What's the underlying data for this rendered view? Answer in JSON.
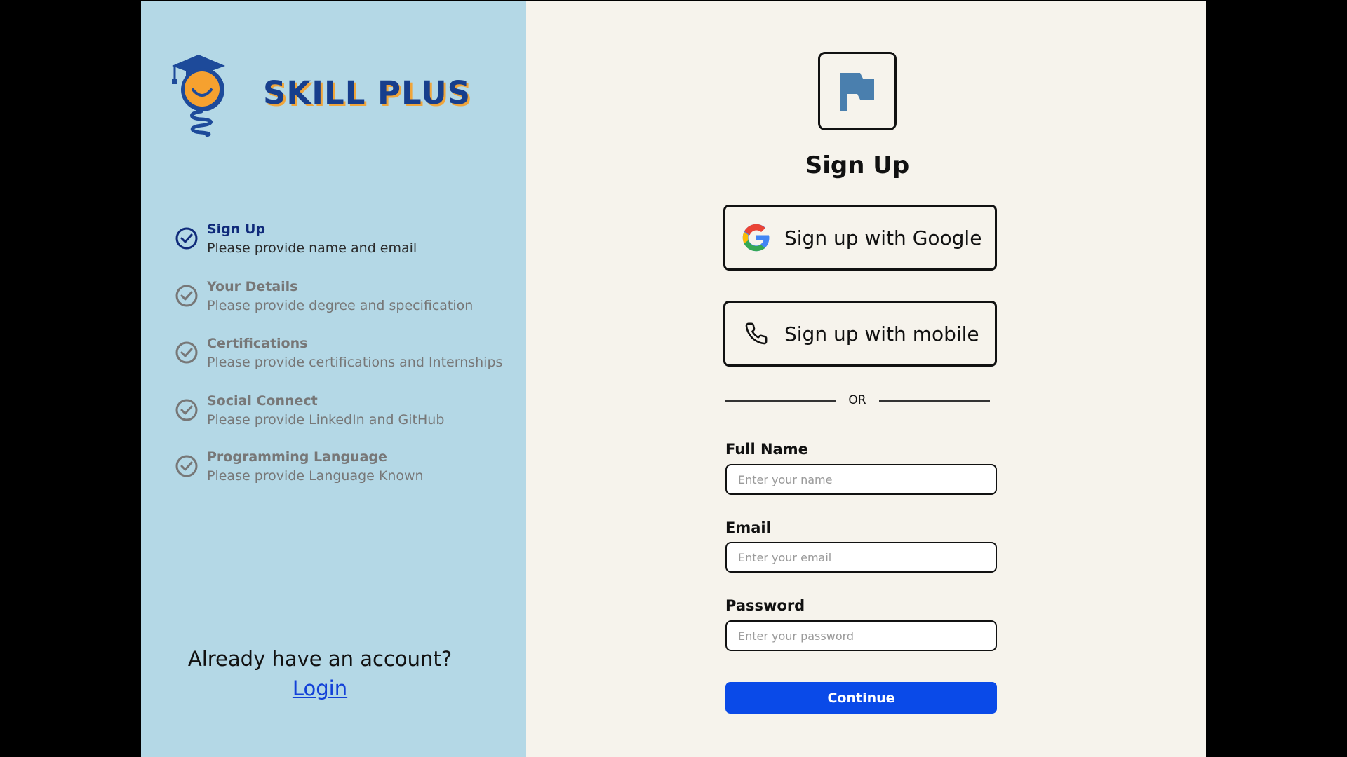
{
  "brand": {
    "name": "SKILL PLUS",
    "logo_icon": "graduation-bulb-logo"
  },
  "steps": [
    {
      "title": "Sign Up",
      "subtitle": "Please provide name and email",
      "active": true
    },
    {
      "title": "Your Details",
      "subtitle": "Please provide degree and specification",
      "active": false
    },
    {
      "title": "Certifications",
      "subtitle": "Please provide certifications and Internships",
      "active": false
    },
    {
      "title": "Social Connect",
      "subtitle": "Please provide LinkedIn and GitHub",
      "active": false
    },
    {
      "title": "Programming Language",
      "subtitle": "Please provide Language Known",
      "active": false
    }
  ],
  "account": {
    "prompt": "Already have an account?",
    "login_label": "Login"
  },
  "form": {
    "header_icon": "flag-icon",
    "heading": "Sign Up",
    "google_label": "Sign up with Google",
    "mobile_label": "Sign up with mobile",
    "divider": "OR",
    "fields": {
      "full_name": {
        "label": "Full Name",
        "placeholder": "Enter your name",
        "value": ""
      },
      "email": {
        "label": "Email",
        "placeholder": "Enter your email",
        "value": ""
      },
      "password": {
        "label": "Password",
        "placeholder": "Enter your password",
        "value": ""
      }
    },
    "continue_label": "Continue"
  },
  "colors": {
    "left_panel": "#b4d8e6",
    "right_panel": "#f6f3ec",
    "accent": "#0a4ae8",
    "active_step": "#0f2a7a",
    "inactive_step": "#777777",
    "flag": "#4a7fae"
  }
}
